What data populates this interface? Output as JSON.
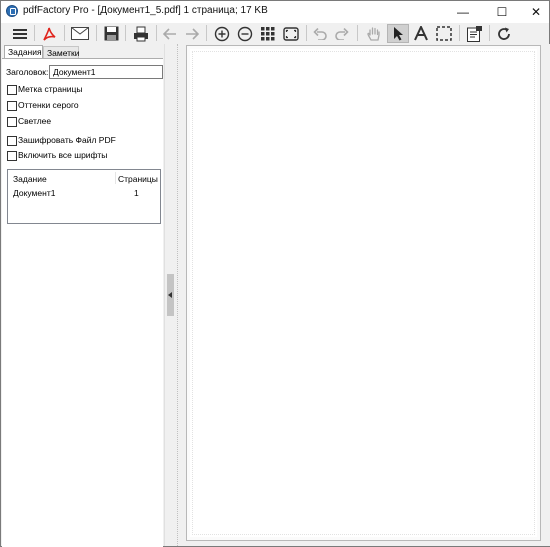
{
  "window": {
    "title": "pdfFactory Pro - [Документ1_5.pdf] 1 страница; 17 KB",
    "minimize_glyph": "—",
    "maximize_glyph": "☐",
    "close_glyph": "✕"
  },
  "toolbar": {
    "items": [
      "menu-icon",
      "pdf-icon",
      "mail-icon",
      "save-icon",
      "print-icon",
      "back-arrow-icon",
      "forward-arrow-icon",
      "zoom-in-icon",
      "zoom-out-icon",
      "thumbnails-icon",
      "fit-page-icon",
      "undo-icon",
      "redo-icon",
      "hand-tool-icon",
      "pointer-tool-icon",
      "text-tool-icon",
      "select-region-icon",
      "notes-icon",
      "refresh-icon"
    ]
  },
  "tabs": {
    "jobs": "Задания",
    "notes": "Заметки"
  },
  "form": {
    "title_label": "Заголовок:",
    "title_value": "Документ1",
    "checkboxes": {
      "page_mark": "Метка страницы",
      "grayscale": "Оттенки серого",
      "lighter": "Светлее",
      "encrypt": "Зашифровать Файл PDF",
      "embed_fonts": "Включить все шрифты"
    }
  },
  "jobs_table": {
    "headers": {
      "job": "Задание",
      "pages": "Страницы"
    },
    "rows": [
      {
        "job": "Документ1",
        "pages": "1"
      }
    ]
  }
}
